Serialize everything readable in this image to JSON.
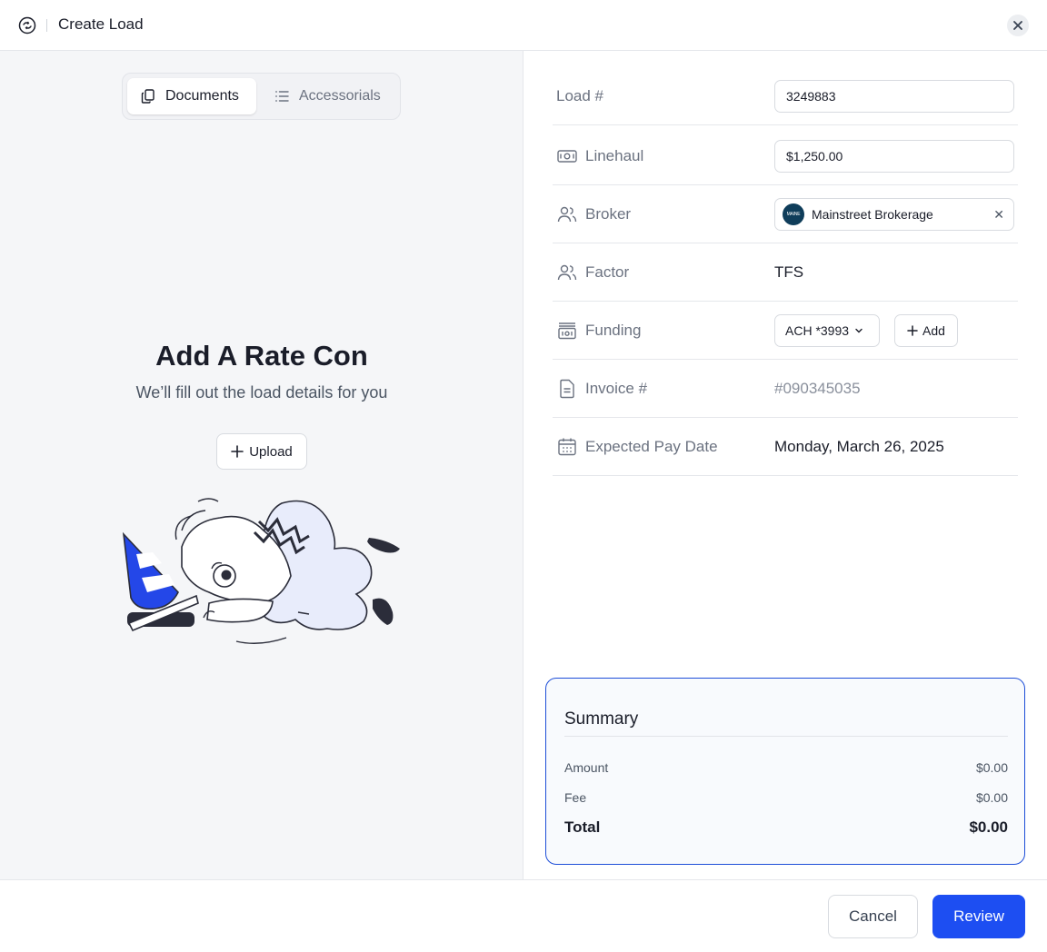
{
  "header": {
    "title": "Create Load"
  },
  "tabs": [
    {
      "label": "Documents",
      "icon": "copy-icon",
      "active": true
    },
    {
      "label": "Accessorials",
      "icon": "list-icon",
      "active": false
    }
  ],
  "empty_state": {
    "title": "Add A Rate Con",
    "subtitle": "We’ll fill out the load details for you",
    "upload_label": "Upload"
  },
  "form": {
    "load_number": {
      "label": "Load #",
      "value": "3249883"
    },
    "linehaul": {
      "label": "Linehaul",
      "value": "$1,250.00",
      "icon": "cash-icon"
    },
    "broker": {
      "label": "Broker",
      "value": "Mainstreet Brokerage",
      "logo_text": "MAINE",
      "icon": "users-icon"
    },
    "factor": {
      "label": "Factor",
      "value": "TFS",
      "icon": "users-icon"
    },
    "funding": {
      "label": "Funding",
      "value": "ACH *3993",
      "add_label": "Add",
      "icon": "bank-icon"
    },
    "invoice": {
      "label": "Invoice #",
      "value": "#090345035",
      "icon": "document-icon"
    },
    "pay_date": {
      "label": "Expected Pay Date",
      "value": "Monday, March 26, 2025",
      "icon": "calendar-icon"
    }
  },
  "summary": {
    "title": "Summary",
    "rows": [
      {
        "label": "Amount",
        "value": "$0.00"
      },
      {
        "label": "Fee",
        "value": "$0.00"
      },
      {
        "label": "Total",
        "value": "$0.00"
      }
    ]
  },
  "footer": {
    "cancel_label": "Cancel",
    "review_label": "Review"
  },
  "colors": {
    "accent": "#1d4ef2",
    "summary_border": "#1d4ed8",
    "panel_bg": "#f5f6f8",
    "broker_logo_bg": "#0f3d5a",
    "cone_blue": "#2447e8"
  }
}
